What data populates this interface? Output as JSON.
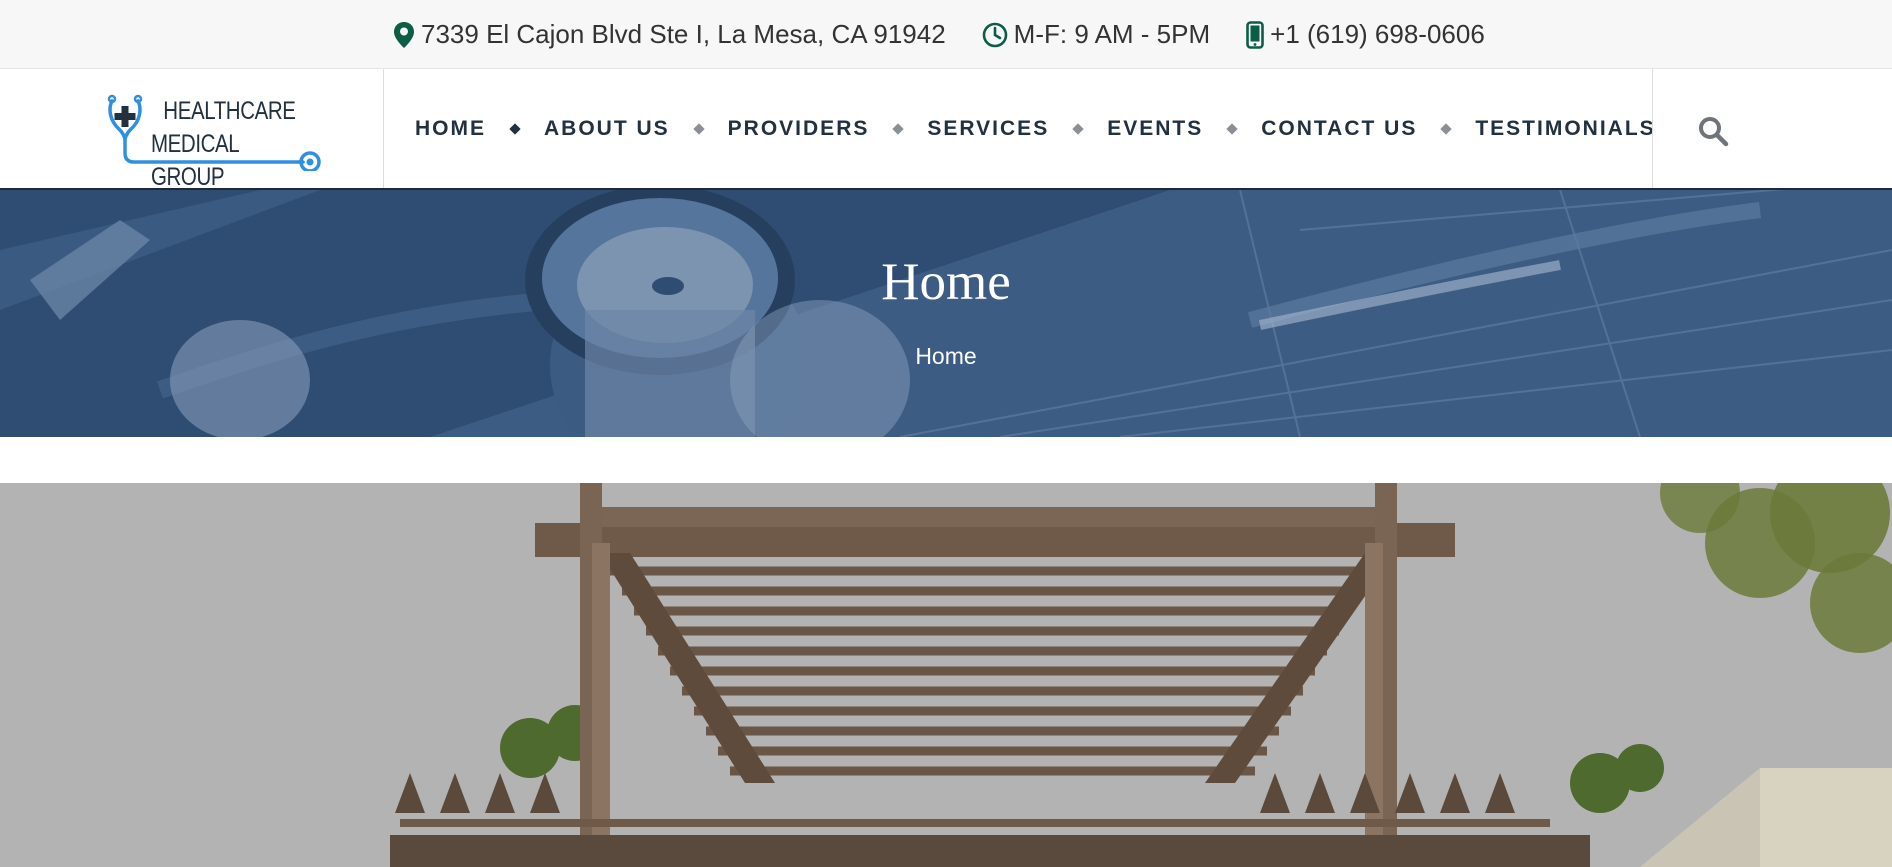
{
  "topbar": {
    "address": "7339 El Cajon Blvd Ste I, La Mesa, CA 91942",
    "hours": "M-F: 9 AM - 5PM",
    "phone": "+1 (619) 698-0606",
    "icons": [
      "map-marker-icon",
      "clock-icon",
      "mobile-phone-icon"
    ],
    "icon_color": "#0b5d45"
  },
  "logo": {
    "line1": "HEALTHCARE",
    "line2": "MEDICAL GROUP",
    "accent": "#2f8fe0"
  },
  "nav": {
    "items": [
      {
        "label": "HOME"
      },
      {
        "label": "ABOUT US"
      },
      {
        "label": "PROVIDERS"
      },
      {
        "label": "SERVICES"
      },
      {
        "label": "EVENTS"
      },
      {
        "label": "CONTACT US"
      },
      {
        "label": "TESTIMONIALS"
      }
    ],
    "search_icon": "search-icon"
  },
  "hero": {
    "title": "Home",
    "breadcrumb": "Home",
    "overlay_color": "#2f4d73"
  }
}
